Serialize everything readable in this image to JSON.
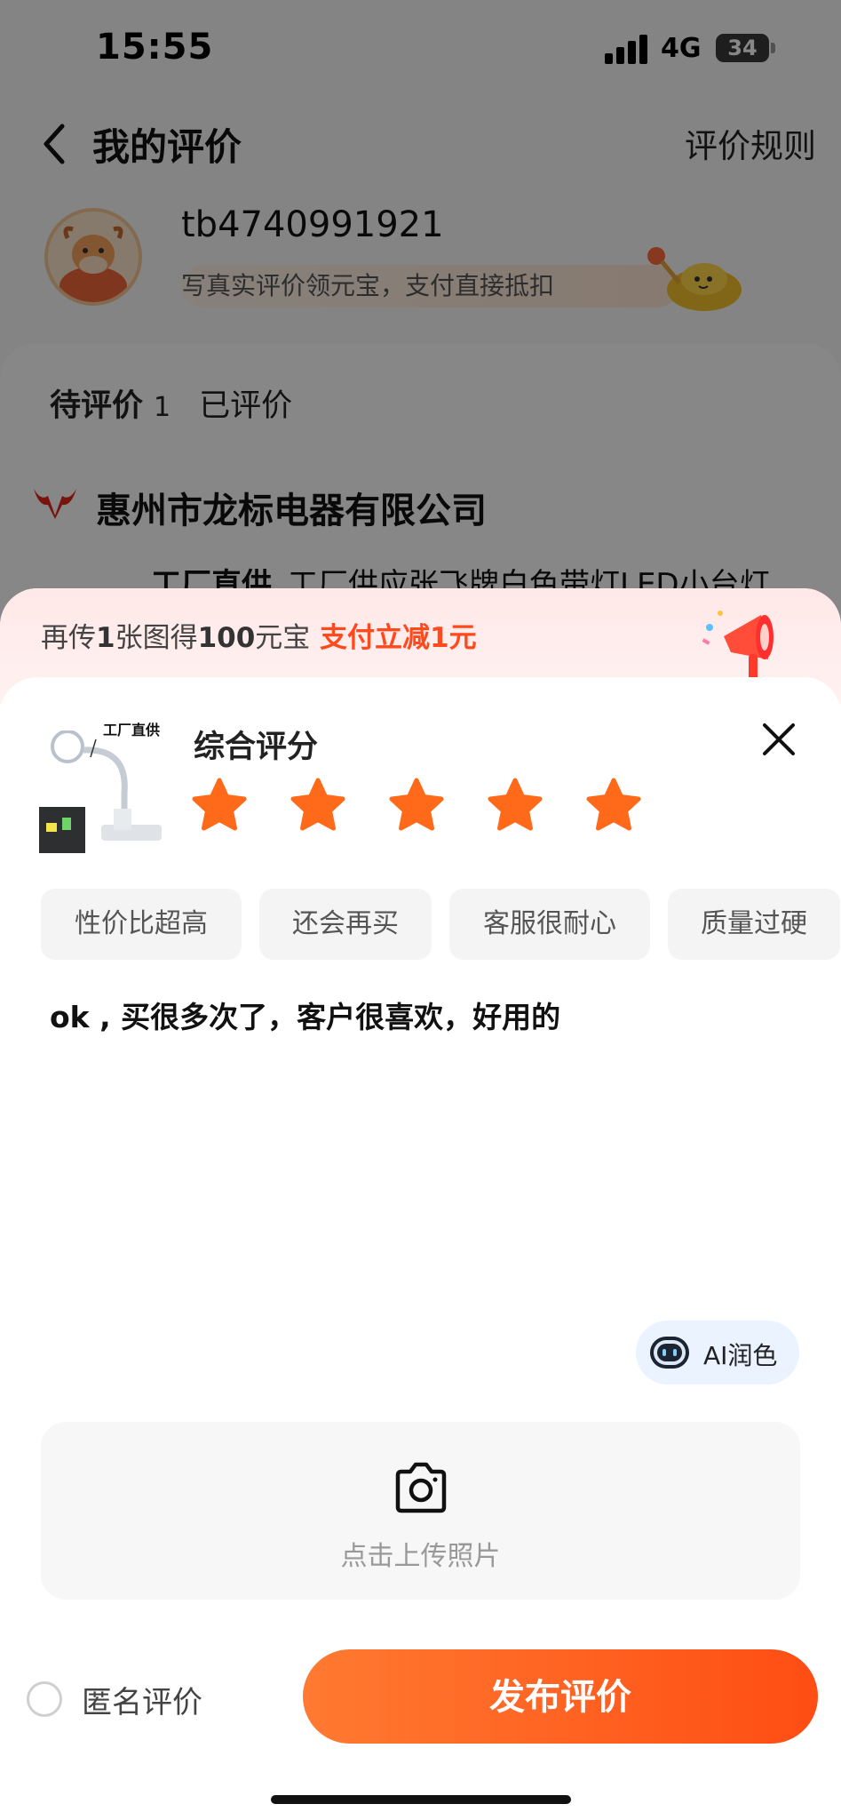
{
  "status_bar": {
    "time": "15:55",
    "network": "4G",
    "battery": "34"
  },
  "header": {
    "title": "我的评价",
    "rules": "评价规则"
  },
  "user": {
    "name": "tb4740991921",
    "tip": "写真实评价领元宝，支付直接抵扣"
  },
  "tabs": {
    "pending_label": "待评价",
    "pending_count": "1",
    "done_label": "已评价"
  },
  "shop": {
    "name": "惠州市龙标电器有限公司",
    "product_badge": "工厂直供",
    "product_title": "工厂供应张飞牌白色带灯LED小台灯..."
  },
  "sheet": {
    "promo_prefix": "再传",
    "promo_count": "1",
    "promo_mid": "张图得",
    "promo_amount": "100",
    "promo_suffix": "元宝",
    "promo_highlight": "支付立减1元",
    "thumb_label": "工厂直供",
    "score_title": "综合评分",
    "rating": 5,
    "tags": [
      "性价比超高",
      "还会再买",
      "客服很耐心",
      "质量过硬"
    ],
    "review_text": "ok , 买很多次了，客户很喜欢，好用的",
    "ai_button": "AI润色",
    "upload_label": "点击上传照片",
    "anonymous_label": "匿名评价",
    "publish_button": "发布评价"
  },
  "colors": {
    "accent": "#ff5a1f",
    "star": "#ff6a1a",
    "promo_red": "#ff4a1d"
  }
}
